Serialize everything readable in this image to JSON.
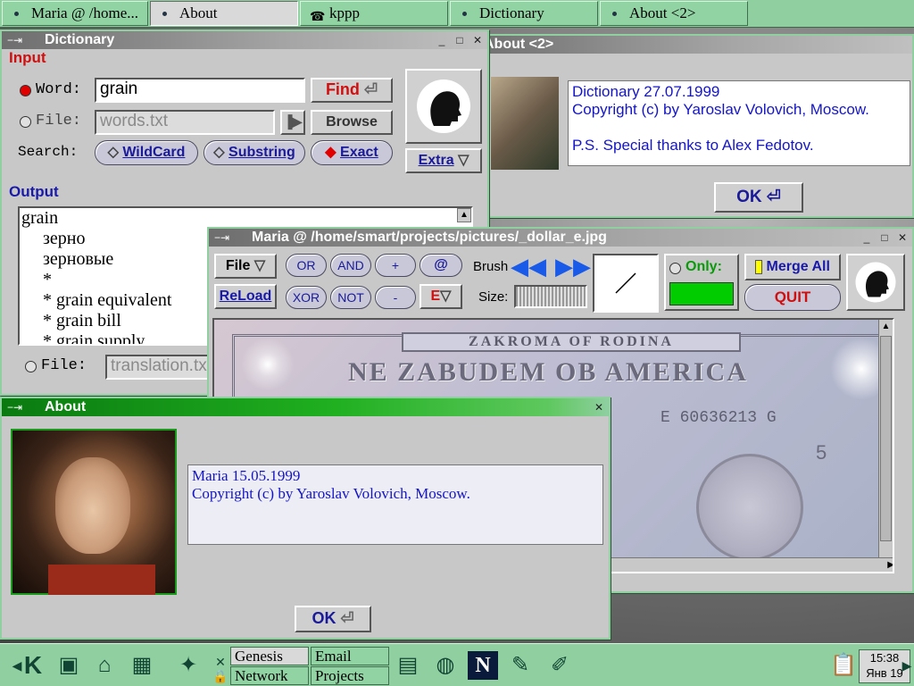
{
  "taskbar": [
    {
      "label": "Maria @ /home..."
    },
    {
      "label": "About",
      "active": true
    },
    {
      "label": "kppp"
    },
    {
      "label": "Dictionary"
    },
    {
      "label": "About <2>"
    }
  ],
  "dictionary": {
    "title": "Dictionary",
    "input_header": "Input",
    "word_label": "Word:",
    "word_value": "grain",
    "find_label": "Find",
    "file_label": "File:",
    "file_value": "words.txt",
    "browse_label": "Browse",
    "search_label": "Search:",
    "wildcard_label": "WildCard",
    "substring_label": "Substring",
    "exact_label": "Exact",
    "extra_label": "Extra",
    "output_header": "Output",
    "output_lines": [
      "grain",
      "зерно",
      "зерновые",
      "*",
      "* grain equivalent",
      "* grain bill",
      "* grain supply"
    ],
    "out_file_label": "File:",
    "out_file_value": "translation.txt"
  },
  "about2": {
    "title": "About <2>",
    "lines": [
      "Dictionary 27.07.1999",
      "Copyright (c) by Yaroslav Volovich, Moscow.",
      "",
      "P.S. Special thanks to Alex Fedotov."
    ],
    "ok_label": "OK"
  },
  "maria": {
    "title": "Maria @ /home/smart/projects/pictures/_dollar_e.jpg",
    "file_label": "File",
    "reload_label": "ReLoad",
    "or_label": "OR",
    "and_label": "AND",
    "plus_label": "+",
    "at_label": "@",
    "xor_label": "XOR",
    "not_label": "NOT",
    "minus_label": "-",
    "e_label": "E",
    "brush_label": "Brush",
    "size_label": "Size:",
    "only_label": "Only:",
    "merge_label": "Merge All",
    "quit_label": "QUIT",
    "only_color": "#00cc00",
    "banknote": {
      "top_text": "ZAKROMA OF RODINA",
      "main_text": "NE ZABUDEM OB AMERICA",
      "serial": "E 60636213 G",
      "denom": "5"
    }
  },
  "about": {
    "title": "About",
    "lines": [
      "Maria 15.05.1999",
      "Copyright (c) by Yaroslav Volovich, Moscow."
    ],
    "ok_label": "OK"
  },
  "panel": {
    "desktops": [
      "Genesis",
      "Email",
      "Network",
      "Projects"
    ],
    "clock_time": "15:38",
    "clock_date": "Янв 19"
  }
}
